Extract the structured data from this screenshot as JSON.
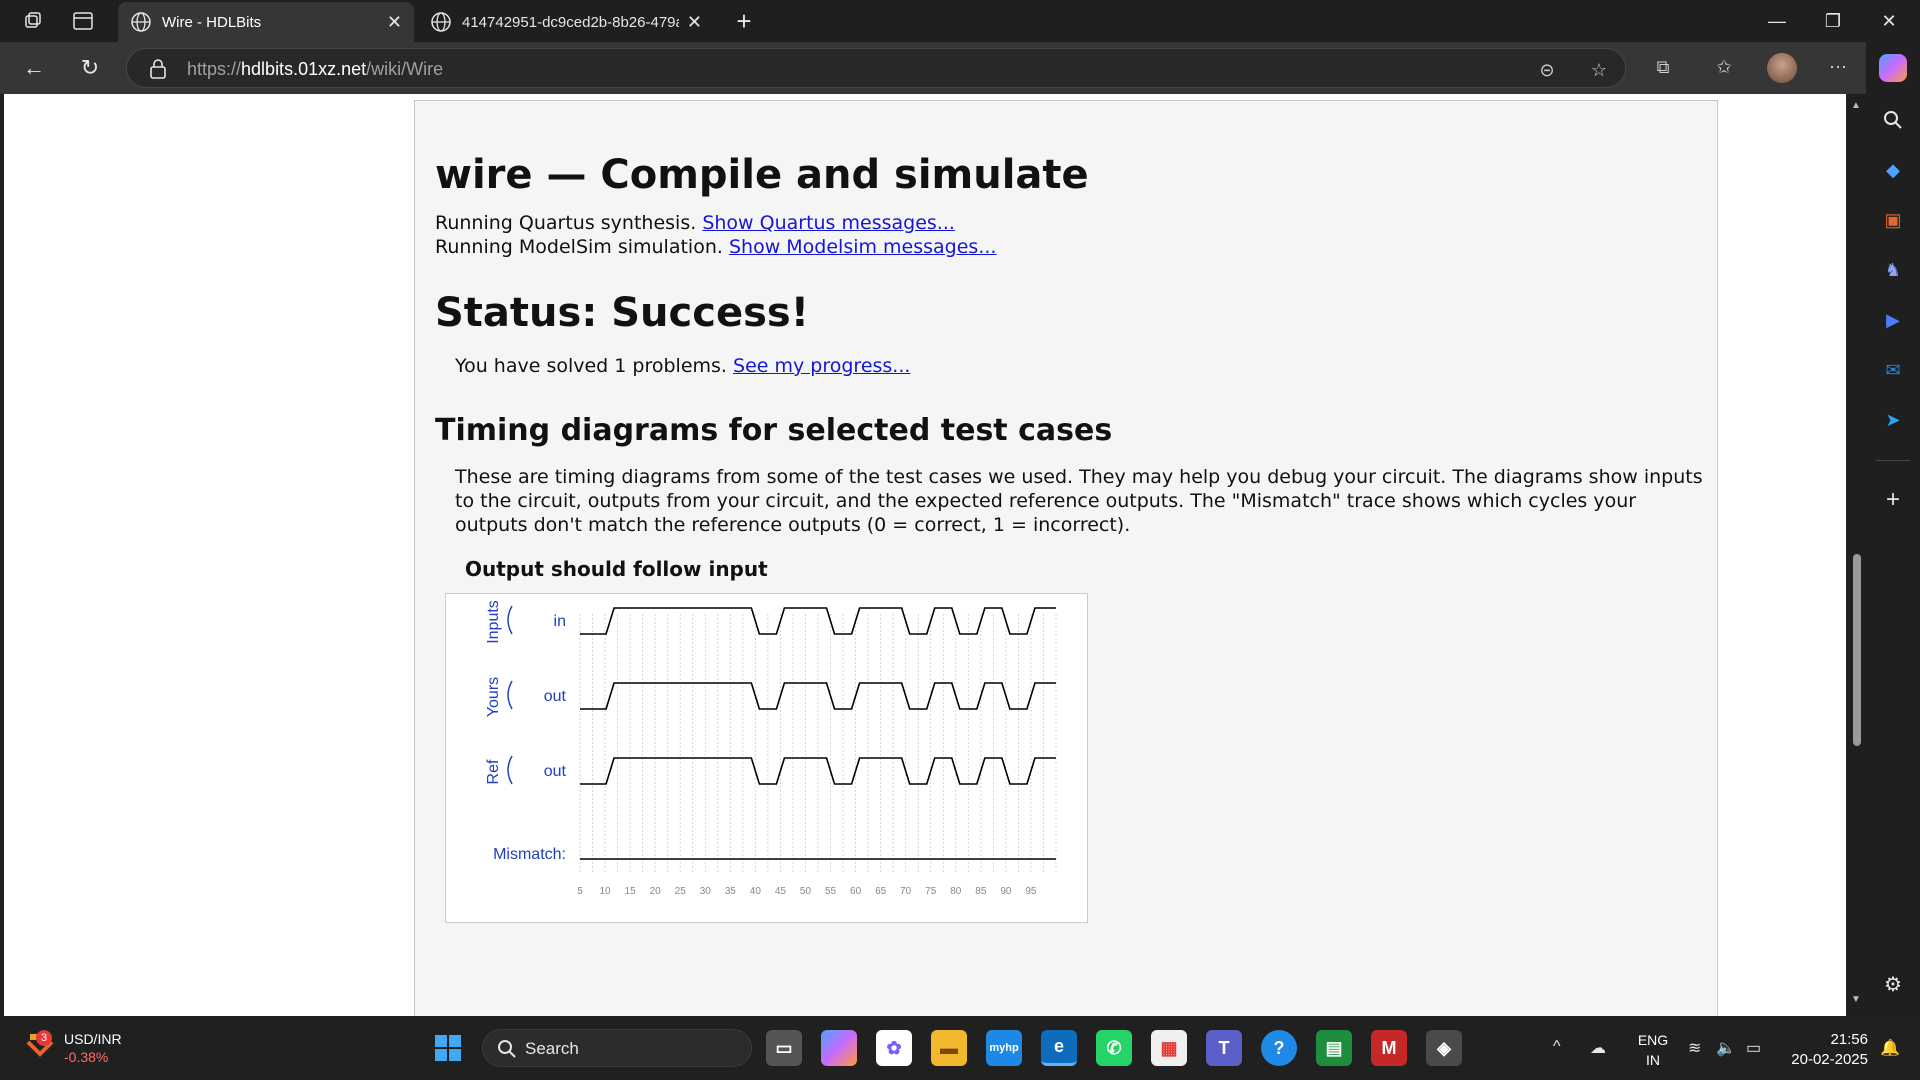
{
  "browser": {
    "tabs": [
      {
        "label": "Wire - HDLBits",
        "active": true
      },
      {
        "label": "414742951-dc9ced2b-8b26-479a",
        "active": false
      }
    ],
    "url": {
      "scheme": "https://",
      "host": "hdlbits.01xz.net",
      "path": "/wiki/Wire"
    }
  },
  "page": {
    "title": "wire — Compile and simulate",
    "quartus_line": "Running Quartus synthesis.",
    "quartus_link": "Show Quartus messages...",
    "modelsim_line": "Running ModelSim simulation.",
    "modelsim_link": "Show Modelsim messages...",
    "status": "Status: Success!",
    "solved_text": "You have solved 1 problems.",
    "progress_link": "See my progress...",
    "timing_heading": "Timing diagrams for selected test cases",
    "timing_desc": "These are timing diagrams from some of the test cases we used. They may help you debug your circuit. The diagrams show inputs to the circuit, outputs from your circuit, and the expected reference outputs. The \"Mismatch\" trace shows which cycles your outputs don't match the reference outputs (0 = correct, 1 = incorrect).",
    "diagram_title": "Output should follow input"
  },
  "chart_data": {
    "type": "line",
    "title": "Output should follow input",
    "groups": [
      "Inputs",
      "Yours",
      "Ref"
    ],
    "x_ticks": [
      5,
      10,
      15,
      20,
      25,
      30,
      35,
      40,
      45,
      50,
      55,
      60,
      65,
      70,
      75,
      80,
      85,
      90,
      95
    ],
    "series": [
      {
        "name": "in",
        "group": "Inputs",
        "x": [
          5,
          11,
          40,
          45,
          55,
          60,
          70,
          75,
          80,
          85,
          90,
          95
        ],
        "values": [
          0,
          1,
          0,
          1,
          0,
          1,
          0,
          1,
          0,
          1,
          0,
          1
        ]
      },
      {
        "name": "out",
        "group": "Yours",
        "x": [
          5,
          11,
          40,
          45,
          55,
          60,
          70,
          75,
          80,
          85,
          90,
          95
        ],
        "values": [
          0,
          1,
          0,
          1,
          0,
          1,
          0,
          1,
          0,
          1,
          0,
          1
        ]
      },
      {
        "name": "out",
        "group": "Ref",
        "x": [
          5,
          11,
          40,
          45,
          55,
          60,
          70,
          75,
          80,
          85,
          90,
          95
        ],
        "values": [
          0,
          1,
          0,
          1,
          0,
          1,
          0,
          1,
          0,
          1,
          0,
          1
        ]
      },
      {
        "name": "Mismatch:",
        "group": "",
        "x": [
          5,
          100
        ],
        "values": [
          0,
          0
        ]
      }
    ],
    "xlim": [
      5,
      100
    ],
    "grid": true,
    "colors": {
      "label": "#1f3fbf",
      "trace": "#000000",
      "grid": "#cccccc"
    }
  },
  "taskbar": {
    "ticker_name": "USD/INR",
    "ticker_change": "-0.38%",
    "ticker_badge": "3",
    "search_label": "Search",
    "lang_top": "ENG",
    "lang_bottom": "IN",
    "time": "21:56",
    "date": "20-02-2025"
  }
}
